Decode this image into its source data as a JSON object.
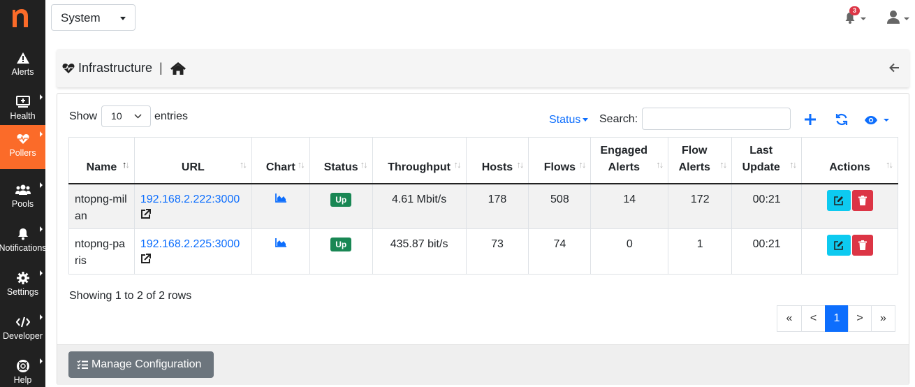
{
  "sidebar": {
    "logo": "n",
    "items": [
      {
        "label": "Alerts",
        "icon": "warning-icon"
      },
      {
        "label": "Health",
        "icon": "monitor-plus-icon"
      },
      {
        "label": "Pollers",
        "icon": "heart-pulse-icon"
      },
      {
        "label": "Pools",
        "icon": "users-icon"
      },
      {
        "label": "Notifications",
        "icon": "bell-icon"
      },
      {
        "label": "Settings",
        "icon": "gear-icon"
      },
      {
        "label": "Developer",
        "icon": "code-icon"
      },
      {
        "label": "Help",
        "icon": "lifebuoy-icon"
      }
    ]
  },
  "topbar": {
    "interface_select": "System",
    "notification_count": "3"
  },
  "header": {
    "title": "Infrastructure",
    "separator": "|"
  },
  "controls": {
    "show_label": "Show",
    "page_size": "10",
    "entries_label": "entries",
    "status_filter": "Status",
    "search_label": "Search:",
    "search_value": ""
  },
  "table": {
    "columns": [
      "Name",
      "URL",
      "Chart",
      "Status",
      "Throughput",
      "Hosts",
      "Flows",
      "Engaged Alerts",
      "Flow Alerts",
      "Last Update",
      "Actions"
    ],
    "rows": [
      {
        "name": "ntopng-milan",
        "url": "192.168.2.222:3000",
        "status": "Up",
        "throughput": "4.61 Mbit/s",
        "hosts": "178",
        "flows": "508",
        "engaged_alerts": "14",
        "flow_alerts": "172",
        "last_update": "00:21"
      },
      {
        "name": "ntopng-paris",
        "url": "192.168.2.225:3000",
        "status": "Up",
        "throughput": "435.87 bit/s",
        "hosts": "73",
        "flows": "74",
        "engaged_alerts": "0",
        "flow_alerts": "1",
        "last_update": "00:21"
      }
    ]
  },
  "footer": {
    "info": "Showing 1 to 2 of 2 rows",
    "pagination": [
      "«",
      "<",
      "1",
      ">",
      "»"
    ],
    "manage_button": "Manage Configuration"
  },
  "colors": {
    "sidebar_bg": "#212121",
    "accent": "#fb6b29",
    "link": "#0d6efd",
    "success": "#198754",
    "danger": "#dc3545",
    "info": "#0dcaf0"
  }
}
